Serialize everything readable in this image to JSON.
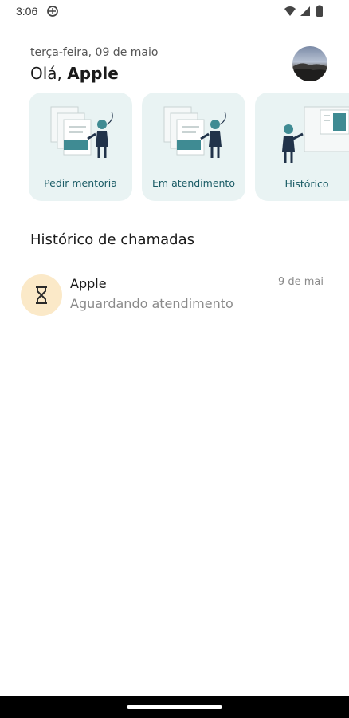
{
  "status_bar": {
    "time": "3:06",
    "icons": [
      "app-notification-icon",
      "wifi-icon",
      "cellular-signal-icon",
      "battery-icon"
    ]
  },
  "header": {
    "date": "terça-feira, 09 de maio",
    "greeting_prefix": "Olá,",
    "user_name": "Apple"
  },
  "cards": [
    {
      "label": "Pedir mentoria",
      "icon": "request-mentoring-illustration"
    },
    {
      "label": "Em atendimento",
      "icon": "in-service-illustration"
    },
    {
      "label": "Histórico",
      "icon": "history-illustration"
    }
  ],
  "section": {
    "title": "Histórico de chamadas"
  },
  "calls": [
    {
      "name": "Apple",
      "status": "Aguardando atendimento",
      "date": "9 de mai",
      "icon": "hourglass-icon"
    }
  ],
  "colors": {
    "card_bg": "#e9f3f3",
    "accent_teal": "#1b5c66",
    "hourglass_bg": "#fbe9c8"
  }
}
